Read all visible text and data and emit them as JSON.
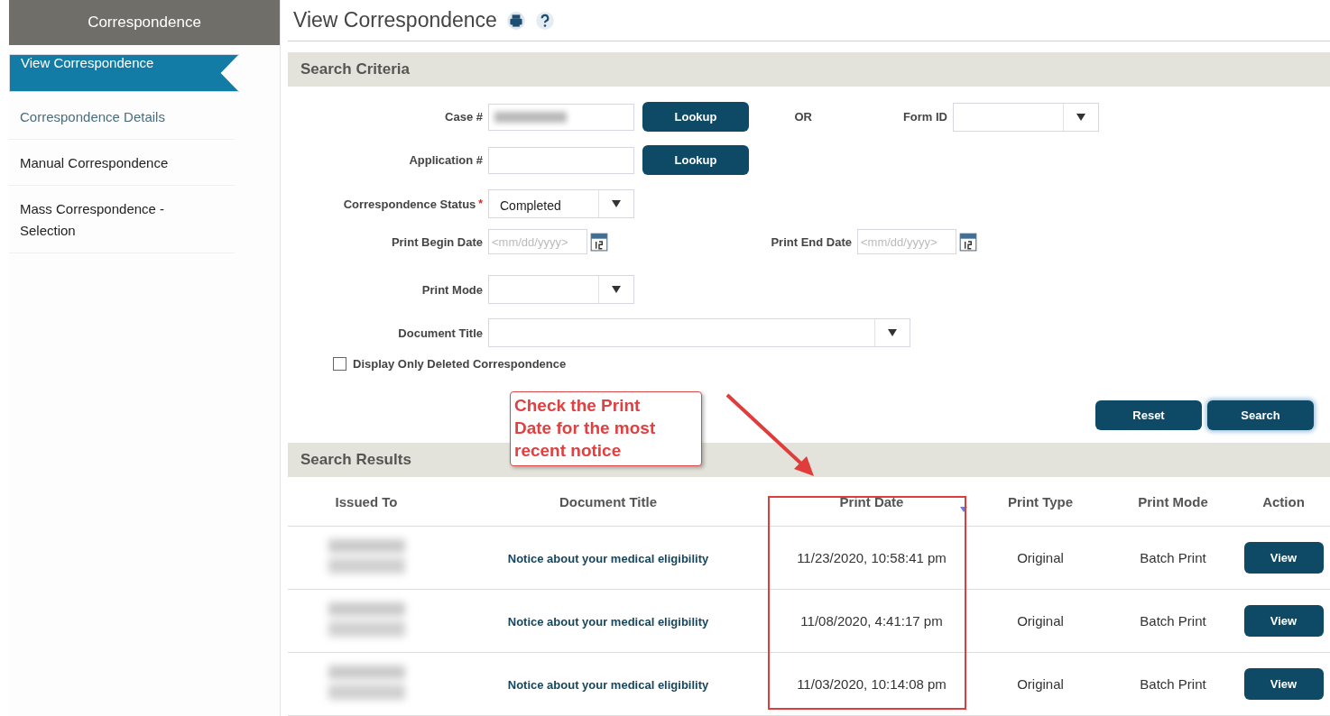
{
  "sidebar": {
    "title": "Correspondence",
    "items": [
      {
        "label": "View Correspondence",
        "selected": true,
        "kind": "plain"
      },
      {
        "label": "Correspondence Details",
        "selected": false,
        "kind": "link"
      },
      {
        "label": "Manual Correspondence",
        "selected": false,
        "kind": "plain"
      },
      {
        "label": "Mass Correspondence - Selection",
        "selected": false,
        "kind": "plain"
      }
    ]
  },
  "page": {
    "title": "View Correspondence"
  },
  "criteria": {
    "title": "Search Criteria",
    "case": {
      "label": "Case #",
      "button": "Lookup"
    },
    "or": "OR",
    "form_id": {
      "label": "Form ID"
    },
    "application": {
      "label": "Application #",
      "button": "Lookup"
    },
    "status": {
      "label": "Correspondence Status",
      "required": true,
      "required_mark": "*",
      "value": "Completed"
    },
    "begin_date": {
      "label": "Print Begin Date",
      "placeholder": "<mm/dd/yyyy>"
    },
    "end_date": {
      "label": "Print End Date",
      "placeholder": "<mm/dd/yyyy>"
    },
    "print_mode": {
      "label": "Print Mode"
    },
    "document_title": {
      "label": "Document Title"
    },
    "deleted_only": {
      "label": "Display Only Deleted Correspondence",
      "checked": false
    },
    "buttons": [
      "Reset",
      "Search"
    ]
  },
  "annotation": {
    "text": "Check the Print Date for the most recent notice"
  },
  "results": {
    "title": "Search Results",
    "columns": [
      {
        "label": "Issued To",
        "sorted": false
      },
      {
        "label": "Document Title",
        "sorted": false
      },
      {
        "label": "Print Date",
        "sorted": true
      },
      {
        "label": "Print Type",
        "sorted": false
      },
      {
        "label": "Print Mode",
        "sorted": false
      },
      {
        "label": "Action",
        "sorted": false
      }
    ],
    "rows": [
      {
        "document_title": "Notice about your medical eligibility",
        "print_date": "11/23/2020, 10:58:41 pm",
        "print_type": "Original",
        "print_mode": "Batch Print",
        "action": "View"
      },
      {
        "document_title": "Notice about your medical eligibility",
        "print_date": "11/08/2020, 4:41:17 pm",
        "print_type": "Original",
        "print_mode": "Batch Print",
        "action": "View"
      },
      {
        "document_title": "Notice about your medical eligibility",
        "print_date": "11/03/2020, 10:14:08 pm",
        "print_type": "Original",
        "print_mode": "Batch Print",
        "action": "View"
      }
    ]
  }
}
